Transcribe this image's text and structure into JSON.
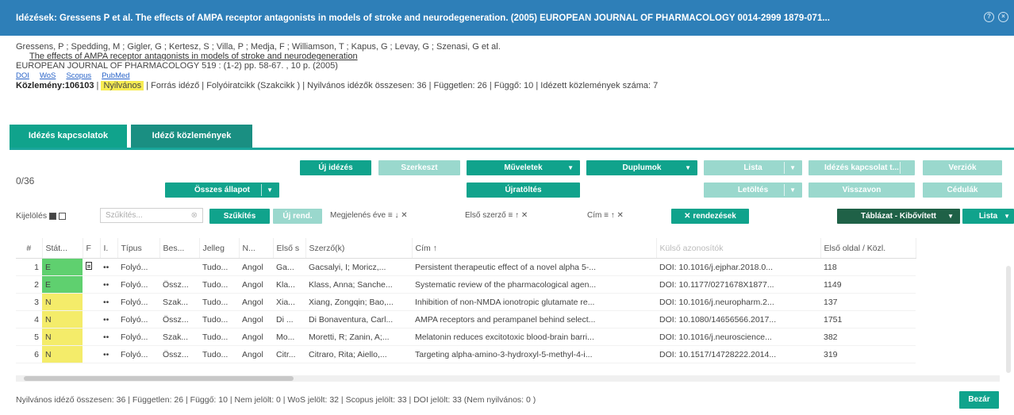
{
  "title_bar": {
    "text": "Idézések: Gressens P et al. The effects of AMPA receptor antagonists in models of stroke and neurodegeneration. (2005) EUROPEAN JOURNAL OF PHARMACOLOGY 0014-2999 1879-071..."
  },
  "publication": {
    "authors": "Gressens, P ; Spedding, M ; Gigler, G ; Kertesz, S ; Villa, P ; Medja, F ; Williamson, T ; Kapus, G ; Levay, G ; Szenasi, G et al.",
    "title_link": "The effects of AMPA receptor antagonists in models of stroke and neurodegeneration",
    "journal": "EUROPEAN JOURNAL OF PHARMACOLOGY 519 : (1-2) pp. 58-67. , 10 p. (2005)",
    "links": [
      "DOI",
      "WoS",
      "Scopus",
      "PubMed"
    ],
    "summary_id": "Közlemény:106103",
    "summary_public": "Nyilvános",
    "summary_rest": "| Forrás idéző | Folyóiratcikk (Szakcikk ) | Nyilvános idézők összesen: 36 | Független: 26 | Függő: 10 | Idézett közlemények száma: 7"
  },
  "tabs": [
    "Idézés kapcsolatok",
    "Idéző közlemények"
  ],
  "toolbar": {
    "uj_idezes": "Új idézés",
    "szerkeszt": "Szerkeszt",
    "muveletek": "Műveletek",
    "duplumok": "Duplumok",
    "lista": "Lista",
    "idezes_kapcsolat": "Idézés kapcsolat t...",
    "verzio": "Verziók",
    "osszes_allapot": "Összes állapot",
    "ujratoltes": "Újratöltés",
    "letoltes": "Letöltés",
    "visszavon": "Visszavon",
    "cedulak": "Cédulák"
  },
  "counter": "0/36",
  "filters": {
    "kijeloles": "Kijelölés",
    "search_placeholder": "Szűkítés...",
    "szukites": "Szűkítés",
    "uj_rend": "Új rend.",
    "sort1": "Megjelenés éve",
    "sort2": "Első szerző",
    "sort3": "Cím",
    "rendezesek": "rendezések",
    "tablazat_kibovitett": "Táblázat - Kibővített",
    "lista": "Lista"
  },
  "table": {
    "headers": [
      "#",
      "Stát...",
      "F",
      "I.",
      "Típus",
      "Bes...",
      "Jelleg",
      "N...",
      "Első s",
      "Szerző(k)",
      "Cím ↑",
      "Külső azonosítók",
      "Első oldal / Közl."
    ],
    "rows": [
      {
        "n": "1",
        "status": "E",
        "f": true,
        "i": "••",
        "tipus": "Folyó...",
        "bes": "",
        "jelleg": "Tudo...",
        "nyelv": "Angol",
        "elso": "Ga...",
        "szerzo": "Gacsalyi, I; Moricz,...",
        "cim": "Persistent therapeutic effect of a novel alpha 5-...",
        "kulso": "DOI: 10.1016/j.ejphar.2018.0...",
        "oldal": "118"
      },
      {
        "n": "2",
        "status": "E",
        "f": false,
        "i": "••",
        "tipus": "Folyó...",
        "bes": "Össz...",
        "jelleg": "Tudo...",
        "nyelv": "Angol",
        "elso": "Kla...",
        "szerzo": "Klass, Anna; Sanche...",
        "cim": "Systematic review of the pharmacological agen...",
        "kulso": "DOI: 10.1177/0271678X1877...",
        "oldal": "1149"
      },
      {
        "n": "3",
        "status": "N",
        "f": false,
        "i": "••",
        "tipus": "Folyó...",
        "bes": "Szak...",
        "jelleg": "Tudo...",
        "nyelv": "Angol",
        "elso": "Xia...",
        "szerzo": "Xiang, Zongqin; Bao,...",
        "cim": "Inhibition of non-NMDA ionotropic glutamate re...",
        "kulso": "DOI: 10.1016/j.neuropharm.2...",
        "oldal": "137"
      },
      {
        "n": "4",
        "status": "N",
        "f": false,
        "i": "••",
        "tipus": "Folyó...",
        "bes": "Össz...",
        "jelleg": "Tudo...",
        "nyelv": "Angol",
        "elso": "Di ...",
        "szerzo": "Di Bonaventura, Carl...",
        "cim": "AMPA receptors and perampanel behind select...",
        "kulso": "DOI: 10.1080/14656566.2017...",
        "oldal": "1751"
      },
      {
        "n": "5",
        "status": "N",
        "f": false,
        "i": "••",
        "tipus": "Folyó...",
        "bes": "Szak...",
        "jelleg": "Tudo...",
        "nyelv": "Angol",
        "elso": "Mo...",
        "szerzo": "Moretti, R; Zanin, A;...",
        "cim": "Melatonin reduces excitotoxic blood-brain barri...",
        "kulso": "DOI: 10.1016/j.neuroscience...",
        "oldal": "382"
      },
      {
        "n": "6",
        "status": "N",
        "f": false,
        "i": "••",
        "tipus": "Folyó...",
        "bes": "Össz...",
        "jelleg": "Tudo...",
        "nyelv": "Angol",
        "elso": "Citr...",
        "szerzo": "Citraro, Rita; Aiello,...",
        "cim": "Targeting alpha-amino-3-hydroxyl-5-methyl-4-i...",
        "kulso": "DOI: 10.1517/14728222.2014...",
        "oldal": "319"
      }
    ]
  },
  "footer": "Nyilvános idéző összesen: 36 | Független: 26 | Függő: 10 | Nem jelölt: 0 | WoS jelölt: 32 | Scopus jelölt: 33 | DOI jelölt: 33 (Nem nyilvános: 0 )",
  "close_button": "Bezár",
  "colors": {
    "title_bg": "#2e7fb8",
    "tab_active": "#10a38c",
    "tab_inactive": "#1a8f82",
    "button": "#10a38c",
    "status_E": "#5fd06f",
    "status_N": "#f4ec6a"
  }
}
